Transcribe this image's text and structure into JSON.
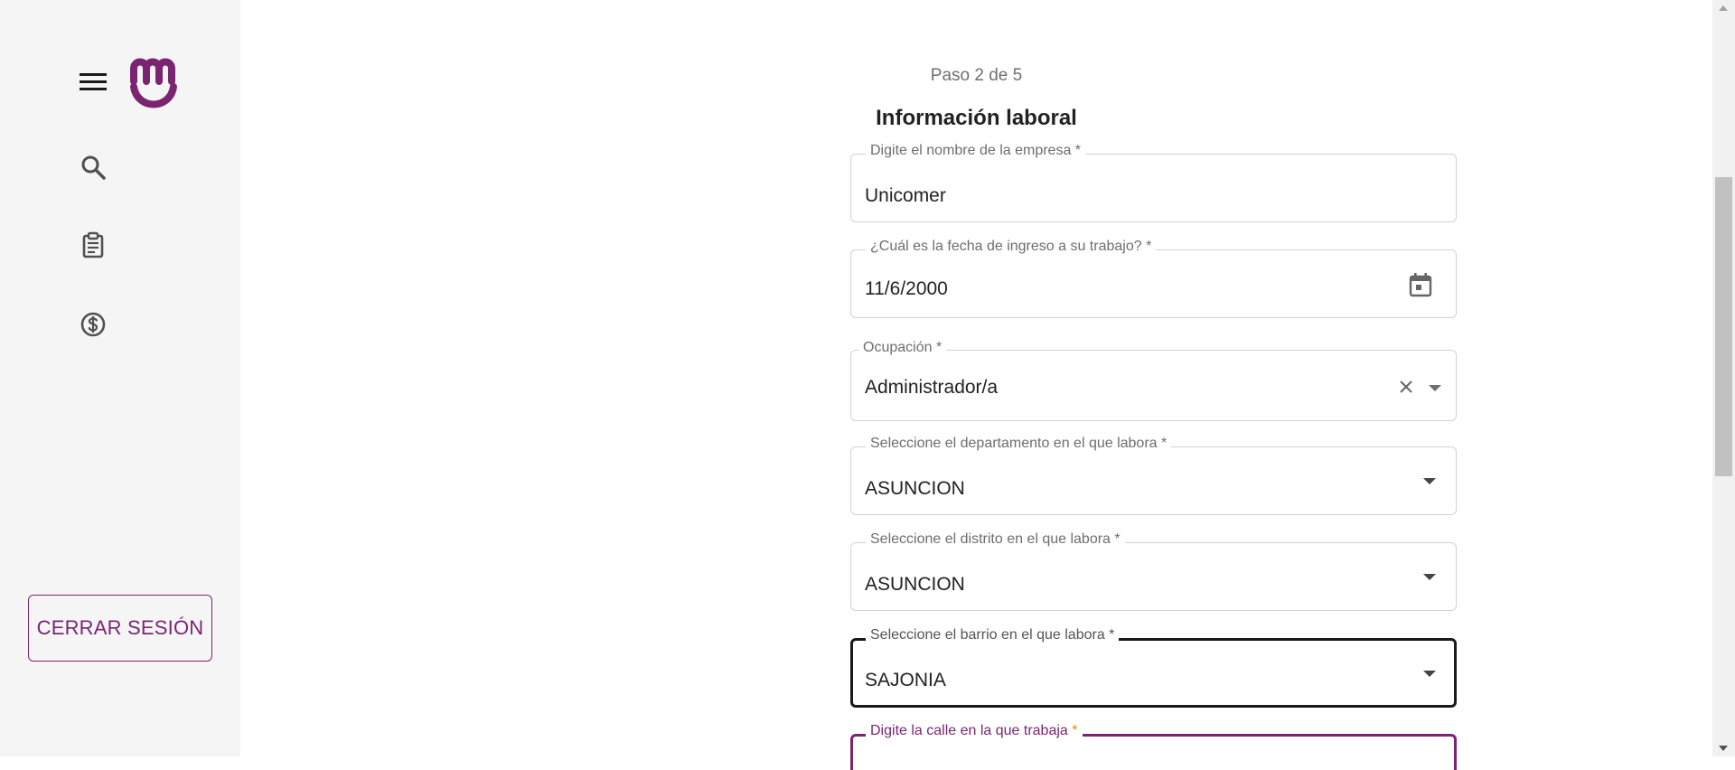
{
  "colors": {
    "brand": "#7b2572",
    "sidebar_bg": "#f5f5f5",
    "focus_border": "#1a1a1a",
    "required_asterisk": "#e88d00"
  },
  "sidebar": {
    "menu_icon": "menu-icon",
    "logo_icon": "brand-logo-icon",
    "nav": [
      {
        "icon": "search-icon"
      },
      {
        "icon": "clipboard-icon"
      },
      {
        "icon": "dollar-circle-icon"
      }
    ],
    "logout_label": "CERRAR SESIÓN"
  },
  "form": {
    "step": "Paso 2 de 5",
    "title": "Información laboral",
    "fields": [
      {
        "label": "Digite el nombre de la empresa *",
        "value": "Unicomer"
      },
      {
        "label": "¿Cuál es la fecha de ingreso a su trabajo? *",
        "value": "11/6/2000",
        "icon": "calendar-icon"
      },
      {
        "label": "Ocupación *",
        "value": "Administrador/a",
        "icons": [
          "close-icon",
          "chevron-down-icon"
        ]
      },
      {
        "label": "Seleccione el departamento en el que labora *",
        "value": "ASUNCION",
        "icon": "chevron-down-icon"
      },
      {
        "label": "Seleccione el distrito en el que labora *",
        "value": "ASUNCION",
        "icon": "chevron-down-icon"
      },
      {
        "label": "Seleccione el barrio en el que labora *",
        "value": "SAJONIA",
        "icon": "chevron-down-icon"
      },
      {
        "label": "Digite la calle en la que trabaja",
        "required_mark": "*",
        "value": ""
      }
    ]
  }
}
